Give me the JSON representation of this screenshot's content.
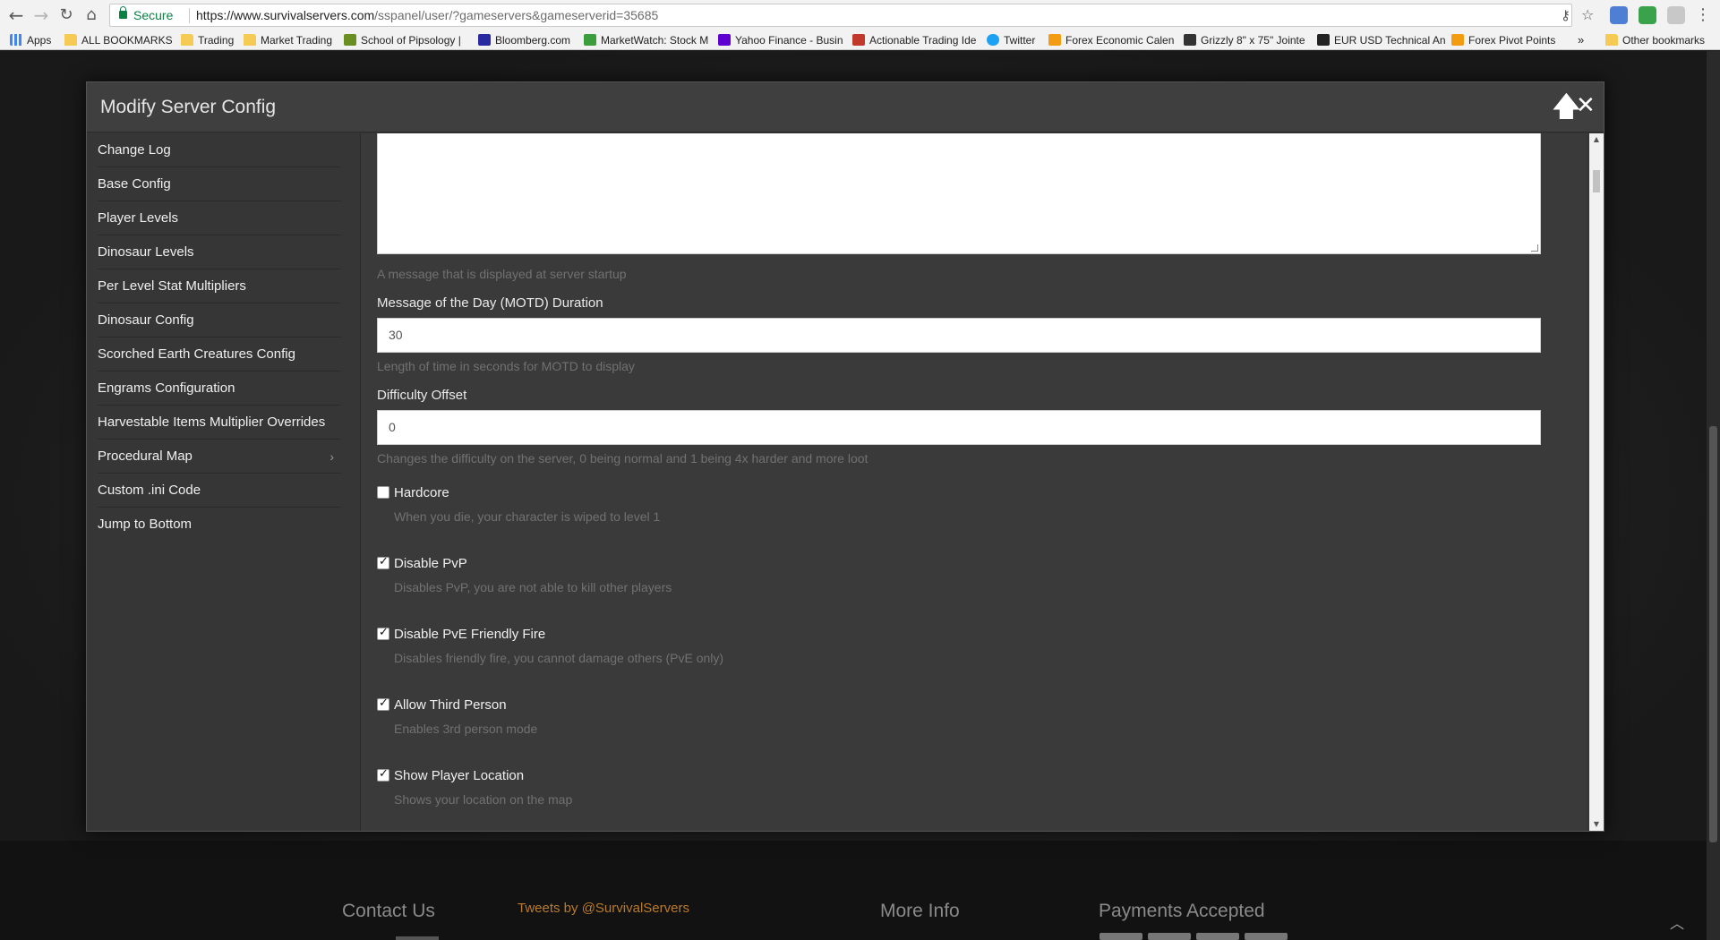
{
  "browser": {
    "secure_label": "Secure",
    "url_main": "https://www.survivalservers.com",
    "url_rest": "/sspanel/user/?gameservers&gameserverid=35685",
    "bookmarks": [
      {
        "label": "Apps",
        "icon": "apps-grid-icon",
        "color": "#4285f4"
      },
      {
        "label": "ALL BOOKMARKS",
        "icon": "folder-icon",
        "color": "#f5cb55"
      },
      {
        "label": "Trading",
        "icon": "folder-icon",
        "color": "#f5cb55"
      },
      {
        "label": "Market Trading",
        "icon": "folder-icon",
        "color": "#f5cb55"
      },
      {
        "label": "School of Pipsology |",
        "icon": "school-icon",
        "color": "#6b8e23"
      },
      {
        "label": "Bloomberg.com",
        "icon": "bloomberg-icon",
        "color": "#2a2aa0"
      },
      {
        "label": "MarketWatch: Stock M",
        "icon": "marketwatch-icon",
        "color": "#3c9d3c"
      },
      {
        "label": "Yahoo Finance - Busin",
        "icon": "yahoo-icon",
        "color": "#5f01d1"
      },
      {
        "label": "Actionable Trading Ide",
        "icon": "trading-icon",
        "color": "#c0392b"
      },
      {
        "label": "Twitter",
        "icon": "twitter-icon",
        "color": "#1da1f2"
      },
      {
        "label": "Forex Economic Calen",
        "icon": "dfx-icon",
        "color": "#f39c12"
      },
      {
        "label": "Grizzly 8\" x 75\" Jointe",
        "icon": "grizzly-icon",
        "color": "#333333"
      },
      {
        "label": "EUR USD Technical An",
        "icon": "investing-icon",
        "color": "#222222"
      },
      {
        "label": "Forex Pivot Points",
        "icon": "dfx-icon",
        "color": "#f39c12"
      }
    ],
    "more": "»",
    "other_bookmarks": "Other bookmarks"
  },
  "modal": {
    "title": "Modify Server Config",
    "sidebar": [
      {
        "label": "Change Log"
      },
      {
        "label": "Base Config"
      },
      {
        "label": "Player Levels"
      },
      {
        "label": "Dinosaur Levels"
      },
      {
        "label": "Per Level Stat Multipliers"
      },
      {
        "label": "Dinosaur Config"
      },
      {
        "label": "Scorched Earth Creatures Config"
      },
      {
        "label": "Engrams Configuration"
      },
      {
        "label": "Harvestable Items Multiplier Overrides"
      },
      {
        "label": "Procedural Map",
        "has_submenu": true
      },
      {
        "label": "Custom .ini Code"
      },
      {
        "label": "Jump to Bottom"
      }
    ],
    "motd_help": "A message that is displayed at server startup",
    "motd_duration": {
      "label": "Message of the Day (MOTD) Duration",
      "value": "30",
      "help": "Length of time in seconds for MOTD to display"
    },
    "difficulty": {
      "label": "Difficulty Offset",
      "value": "0",
      "help": "Changes the difficulty on the server, 0 being normal and 1 being 4x harder and more loot"
    },
    "checkboxes": [
      {
        "label": "Hardcore",
        "help": "When you die, your character is wiped to level 1",
        "checked": false
      },
      {
        "label": "Disable PvP",
        "help": "Disables PvP, you are not able to kill other players",
        "checked": true
      },
      {
        "label": "Disable PvE Friendly Fire",
        "help": "Disables friendly fire, you cannot damage others (PvE only)",
        "checked": true
      },
      {
        "label": "Allow Third Person",
        "help": "Enables 3rd person mode",
        "checked": true
      },
      {
        "label": "Show Player Location",
        "help": "Shows your location on the map",
        "checked": true
      }
    ]
  },
  "footer": {
    "contact": "Contact Us",
    "tweets": "Tweets by @SurvivalServers",
    "more_info": "More Info",
    "payments": "Payments Accepted"
  }
}
